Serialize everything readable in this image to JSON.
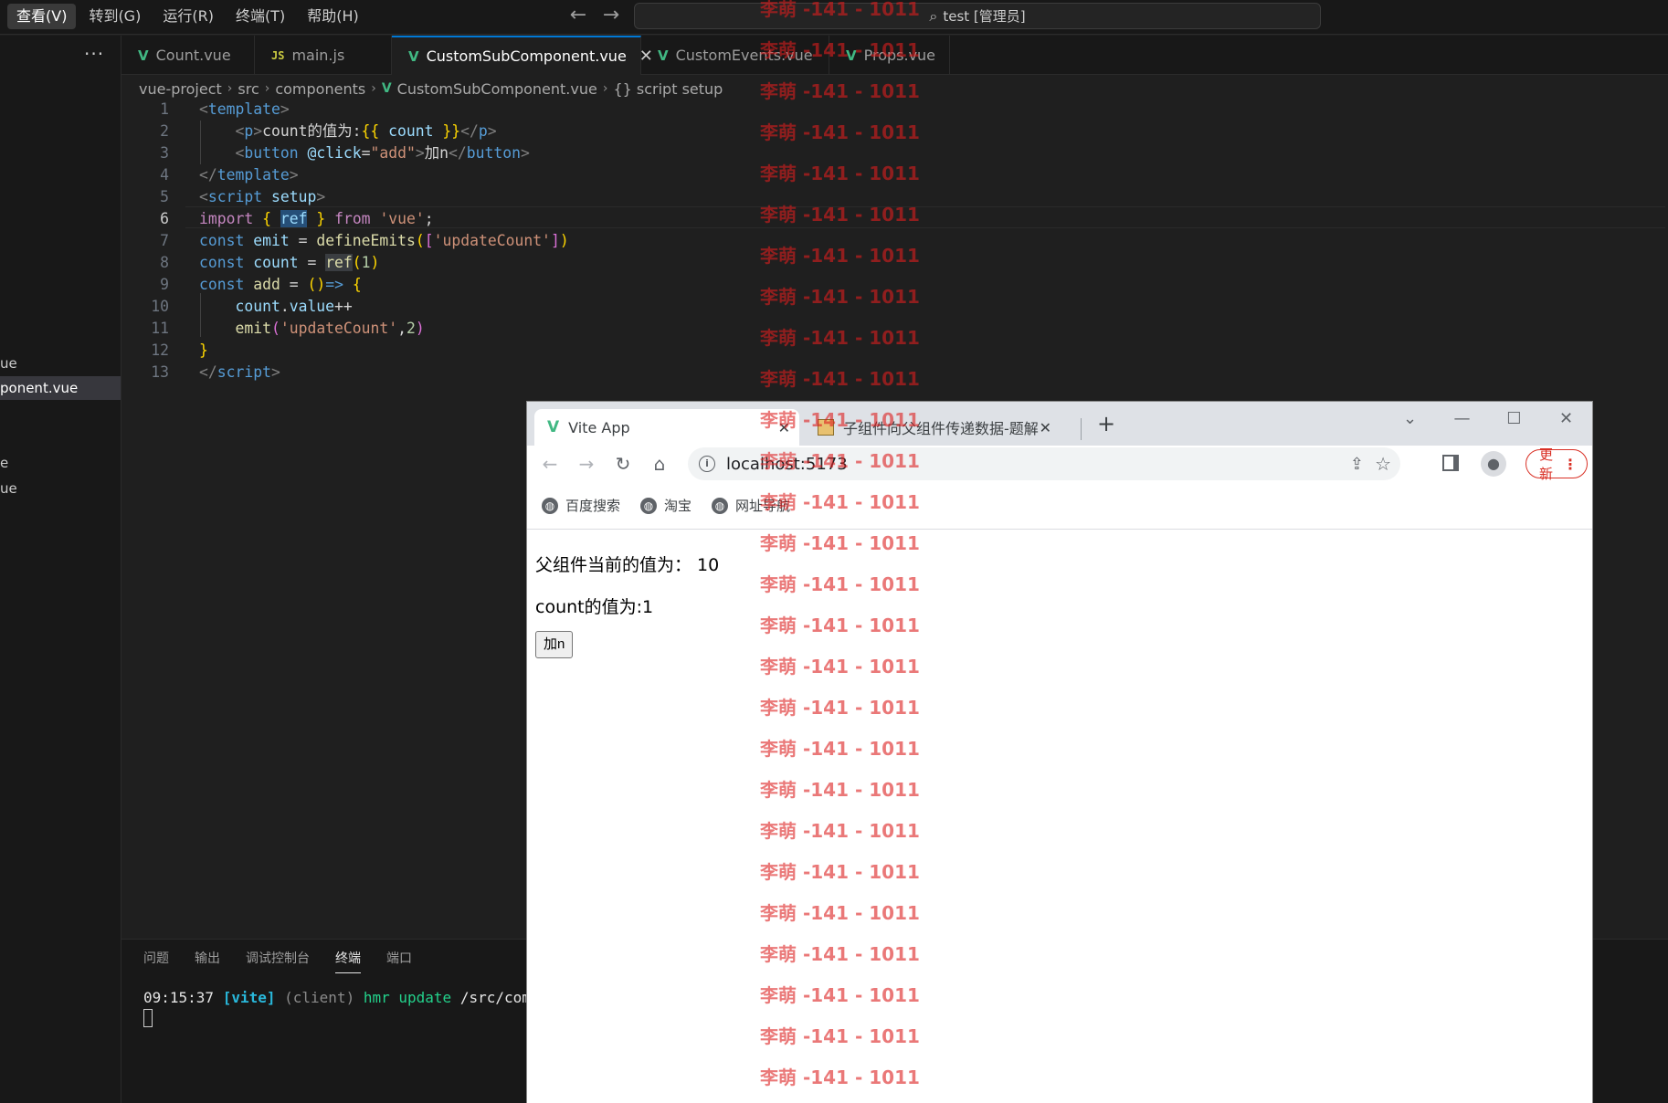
{
  "menu": {
    "items": [
      "查看(V)",
      "转到(G)",
      "运行(R)",
      "终端(T)",
      "帮助(H)"
    ]
  },
  "title_search": {
    "text": "test [管理员]"
  },
  "sidebar": {
    "items": [
      "ue",
      "ponent.vue",
      "e",
      "ue"
    ],
    "selected_index": 1
  },
  "tabs": [
    {
      "label": "Count.vue",
      "icon": "vue"
    },
    {
      "label": "main.js",
      "icon": "js"
    },
    {
      "label": "CustomSubComponent.vue",
      "icon": "vue",
      "active": true
    },
    {
      "label": "CustomEvents.vue",
      "icon": "vue"
    },
    {
      "label": "Props.vue",
      "icon": "vue"
    }
  ],
  "js_badge": "JS",
  "breadcrumb": {
    "parts": [
      "vue-project",
      "src",
      "components",
      "CustomSubComponent.vue",
      "{} script setup"
    ]
  },
  "code": {
    "line_numbers": [
      "1",
      "2",
      "3",
      "4",
      "5",
      "6",
      "7",
      "8",
      "9",
      "10",
      "11",
      "12",
      "13"
    ],
    "current_line": 6
  },
  "panel": {
    "tabs": [
      "问题",
      "输出",
      "调试控制台",
      "终端",
      "端口"
    ],
    "active_tab": "终端",
    "terminal": {
      "time": "09:15:37",
      "tag": "[vite]",
      "client": "(client)",
      "msg": "hmr update",
      "path": "/src/compor"
    }
  },
  "browser": {
    "tabs": [
      "Vite App",
      "子组件向父组件传递数据-题解"
    ],
    "url": "localhost:5173",
    "update_label": "更新",
    "bookmarks": [
      "百度搜索",
      "淘宝",
      "网址导航"
    ],
    "page": {
      "parent_text": "父组件当前的值为：  10",
      "child_text": "count的值为:1",
      "button_label": "加n"
    }
  },
  "watermark": {
    "text": "李萌 -141 - 1011",
    "count": 27
  },
  "colors": {
    "accent": "#0078d4",
    "vue_green": "#41b883",
    "watermark_red": "#dc1e1e",
    "chrome_update_red": "#d93025"
  }
}
